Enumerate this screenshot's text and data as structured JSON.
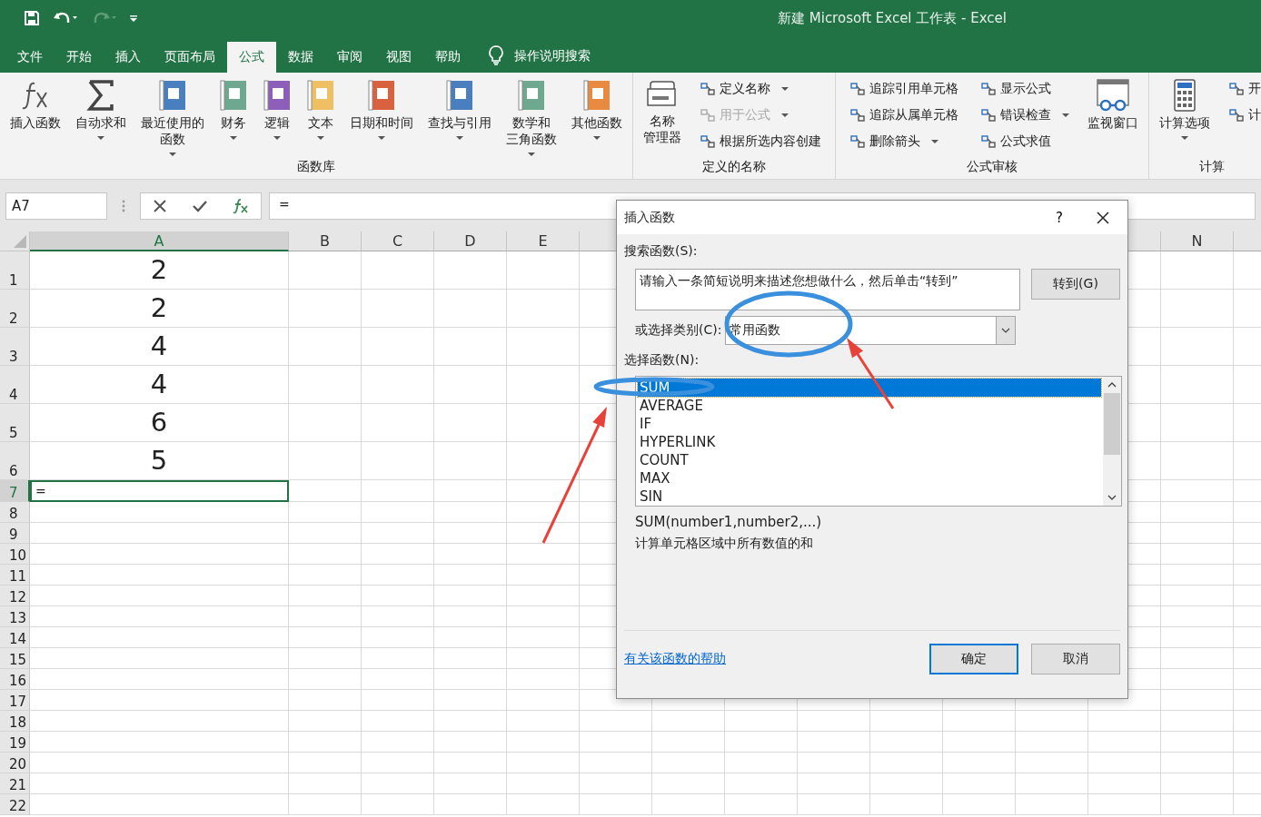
{
  "window": {
    "title": "新建 Microsoft Excel 工作表 - Excel"
  },
  "tabs": [
    {
      "label": "文件",
      "selected": false
    },
    {
      "label": "开始",
      "selected": false
    },
    {
      "label": "插入",
      "selected": false
    },
    {
      "label": "页面布局",
      "selected": false
    },
    {
      "label": "公式",
      "selected": true
    },
    {
      "label": "数据",
      "selected": false
    },
    {
      "label": "审阅",
      "selected": false
    },
    {
      "label": "视图",
      "selected": false
    },
    {
      "label": "帮助",
      "selected": false
    }
  ],
  "tell_me": "操作说明搜索",
  "ribbon_groups": [
    {
      "label": "函数库",
      "items": [
        {
          "kind": "fx",
          "lines": [
            "插入函数"
          ],
          "dropdown": false
        },
        {
          "kind": "sum",
          "lines": [
            "自动求和"
          ],
          "dropdown": true
        },
        {
          "kind": "book",
          "color": "#4a7fbf",
          "lines": [
            "最近使用的",
            "函数"
          ],
          "dropdown": true
        },
        {
          "kind": "book",
          "color": "#6ea88f",
          "lines": [
            "财务"
          ],
          "dropdown": true
        },
        {
          "kind": "book",
          "color": "#8e5fb8",
          "lines": [
            "逻辑"
          ],
          "dropdown": true
        },
        {
          "kind": "book",
          "color": "#eec063",
          "lines": [
            "文本"
          ],
          "dropdown": true
        },
        {
          "kind": "book",
          "color": "#d9613f",
          "lines": [
            "日期和时间"
          ],
          "dropdown": true
        },
        {
          "kind": "book",
          "color": "#4a7fbf",
          "lines": [
            "查找与引用"
          ],
          "dropdown": true
        },
        {
          "kind": "book",
          "color": "#6ea88f",
          "lines": [
            "数学和",
            "三角函数"
          ],
          "dropdown": true
        },
        {
          "kind": "book",
          "color": "#e88a3f",
          "lines": [
            "其他函数"
          ],
          "dropdown": true
        }
      ]
    },
    {
      "label": "定义的名称",
      "items": [
        {
          "kind": "names",
          "lines": [
            "名称",
            "管理器"
          ],
          "dropdown": false
        },
        {
          "kind": "stack",
          "items": [
            {
              "label": "定义名称",
              "dropdown": true,
              "disabled": false
            },
            {
              "label": "用于公式",
              "dropdown": true,
              "disabled": true
            },
            {
              "label": "根据所选内容创建",
              "dropdown": false,
              "disabled": false
            }
          ]
        }
      ]
    },
    {
      "label": "公式审核",
      "items": [
        {
          "kind": "stack",
          "items": [
            {
              "label": "追踪引用单元格",
              "dropdown": false,
              "disabled": false
            },
            {
              "label": "追踪从属单元格",
              "dropdown": false,
              "disabled": false
            },
            {
              "label": "删除箭头",
              "dropdown": true,
              "disabled": false
            }
          ]
        },
        {
          "kind": "stack",
          "items": [
            {
              "label": "显示公式",
              "dropdown": false,
              "disabled": false
            },
            {
              "label": "错误检查",
              "dropdown": true,
              "disabled": false
            },
            {
              "label": "公式求值",
              "dropdown": false,
              "disabled": false
            }
          ]
        },
        {
          "kind": "watch",
          "lines": [
            "监视窗口"
          ],
          "dropdown": false
        }
      ]
    },
    {
      "label": "计算",
      "items": [
        {
          "kind": "calc",
          "lines": [
            "计算选项"
          ],
          "dropdown": true
        },
        {
          "kind": "stack",
          "items": [
            {
              "label": "开",
              "dropdown": false,
              "disabled": false
            },
            {
              "label": "计",
              "dropdown": false,
              "disabled": false
            }
          ]
        }
      ]
    }
  ],
  "formula_bar": {
    "name_box": "A7",
    "formula": "="
  },
  "sheet": {
    "columns": [
      {
        "label": "A",
        "selected": true
      },
      {
        "label": "B",
        "selected": false
      },
      {
        "label": "C",
        "selected": false
      },
      {
        "label": "D",
        "selected": false
      },
      {
        "label": "E",
        "selected": false
      },
      {
        "label": "N",
        "selected": false
      }
    ],
    "rows": [
      {
        "header": "1",
        "value": "2",
        "selected": false
      },
      {
        "header": "2",
        "value": "2",
        "selected": false
      },
      {
        "header": "3",
        "value": "4",
        "selected": false
      },
      {
        "header": "4",
        "value": "4",
        "selected": false
      },
      {
        "header": "5",
        "value": "6",
        "selected": false
      },
      {
        "header": "6",
        "value": "5",
        "selected": false
      },
      {
        "header": "7",
        "value": "=",
        "selected": true
      },
      {
        "header": "8",
        "selected": false
      },
      {
        "header": "9",
        "selected": false
      },
      {
        "header": "10",
        "selected": false
      },
      {
        "header": "11",
        "selected": false
      },
      {
        "header": "12",
        "selected": false
      },
      {
        "header": "13",
        "selected": false
      },
      {
        "header": "14",
        "selected": false
      },
      {
        "header": "15",
        "selected": false
      },
      {
        "header": "16",
        "selected": false
      },
      {
        "header": "17",
        "selected": false
      },
      {
        "header": "18",
        "selected": false
      },
      {
        "header": "19",
        "selected": false
      },
      {
        "header": "20",
        "selected": false
      },
      {
        "header": "21",
        "selected": false
      },
      {
        "header": "22",
        "selected": false
      }
    ]
  },
  "dialog": {
    "title": "插入函数",
    "help_button": "?",
    "search_label": "搜索函数(S):",
    "search_value": "请输入一条简短说明来描述您想做什么，然后单击“转到”",
    "go_button": "转到(G)",
    "category_label": "或选择类别(C):",
    "category": "常用函数",
    "list_label": "选择函数(N):",
    "functions": [
      {
        "name": "SUM",
        "selected": true
      },
      {
        "name": "AVERAGE",
        "selected": false
      },
      {
        "name": "IF",
        "selected": false
      },
      {
        "name": "HYPERLINK",
        "selected": false
      },
      {
        "name": "COUNT",
        "selected": false
      },
      {
        "name": "MAX",
        "selected": false
      },
      {
        "name": "SIN",
        "selected": false
      }
    ],
    "signature": "SUM(number1,number2,...)",
    "description": "计算单元格区域中所有数值的和",
    "help_link": "有关该函数的帮助",
    "ok_button": "确定",
    "cancel_button": "取消"
  },
  "annotations": [
    {
      "kind": "circle"
    },
    {
      "kind": "circle"
    },
    {
      "kind": "arrow"
    },
    {
      "kind": "arrow"
    }
  ]
}
